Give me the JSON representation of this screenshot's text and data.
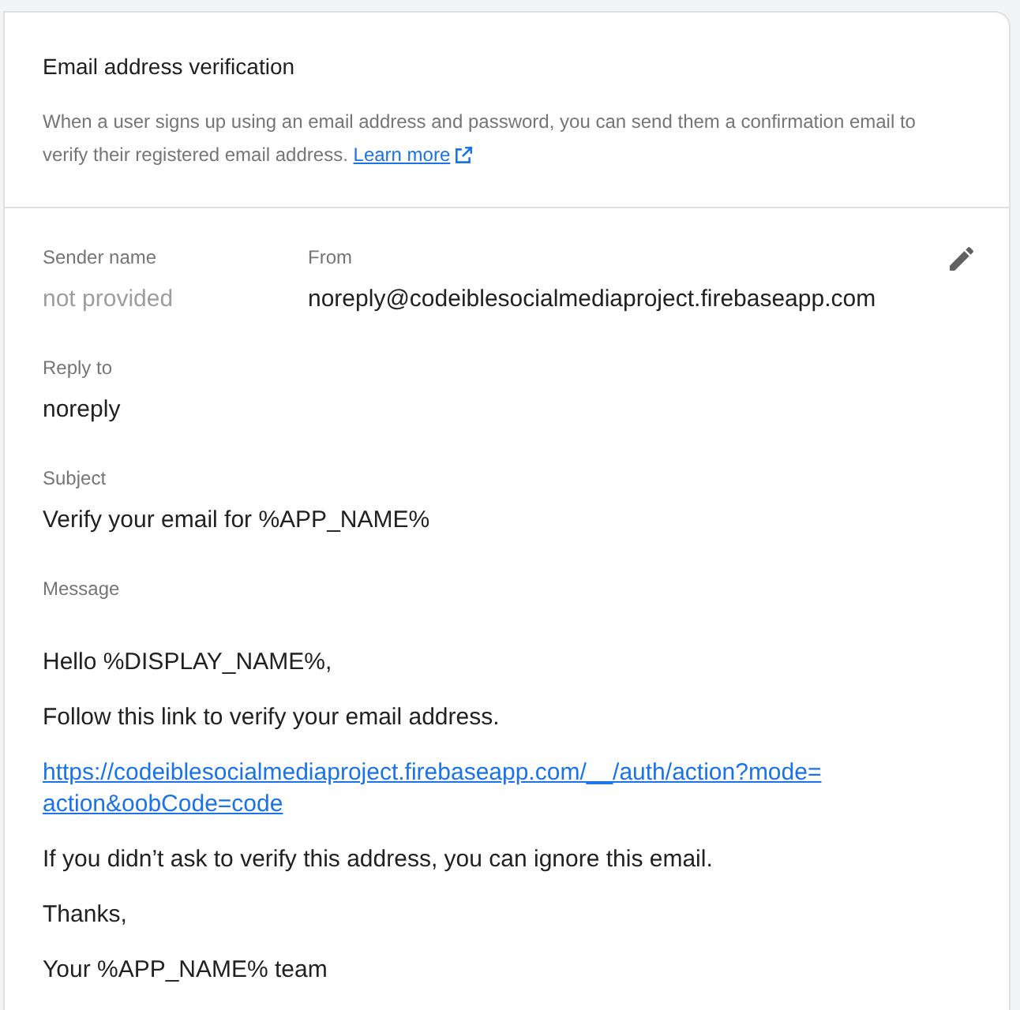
{
  "card": {
    "title": "Email address verification",
    "description": "When a user signs up using an email address and password, you can send them a confirmation email to verify their registered email address.",
    "learn_more": "Learn more"
  },
  "fields": {
    "sender_name": {
      "label": "Sender name",
      "value": "not provided",
      "provided": false
    },
    "from": {
      "label": "From",
      "value": "noreply@codeiblesocialmediaproject.firebaseapp.com"
    },
    "reply_to": {
      "label": "Reply to",
      "value": "noreply"
    },
    "subject": {
      "label": "Subject",
      "value": "Verify your email for %APP_NAME%"
    }
  },
  "message": {
    "label": "Message",
    "paragraphs": [
      {
        "kind": "text",
        "text": "Hello %DISPLAY_NAME%,"
      },
      {
        "kind": "text",
        "text": "Follow this link to verify your email address."
      },
      {
        "kind": "link",
        "text": "https://codeiblesocialmediaproject.firebaseapp.com/__/auth/action?mode=action&oobCode=code"
      },
      {
        "kind": "text",
        "text": "If you didn’t ask to verify this address, you can ignore this email."
      },
      {
        "kind": "text",
        "text": "Thanks,"
      },
      {
        "kind": "text",
        "text": "Your %APP_NAME% team"
      }
    ]
  }
}
